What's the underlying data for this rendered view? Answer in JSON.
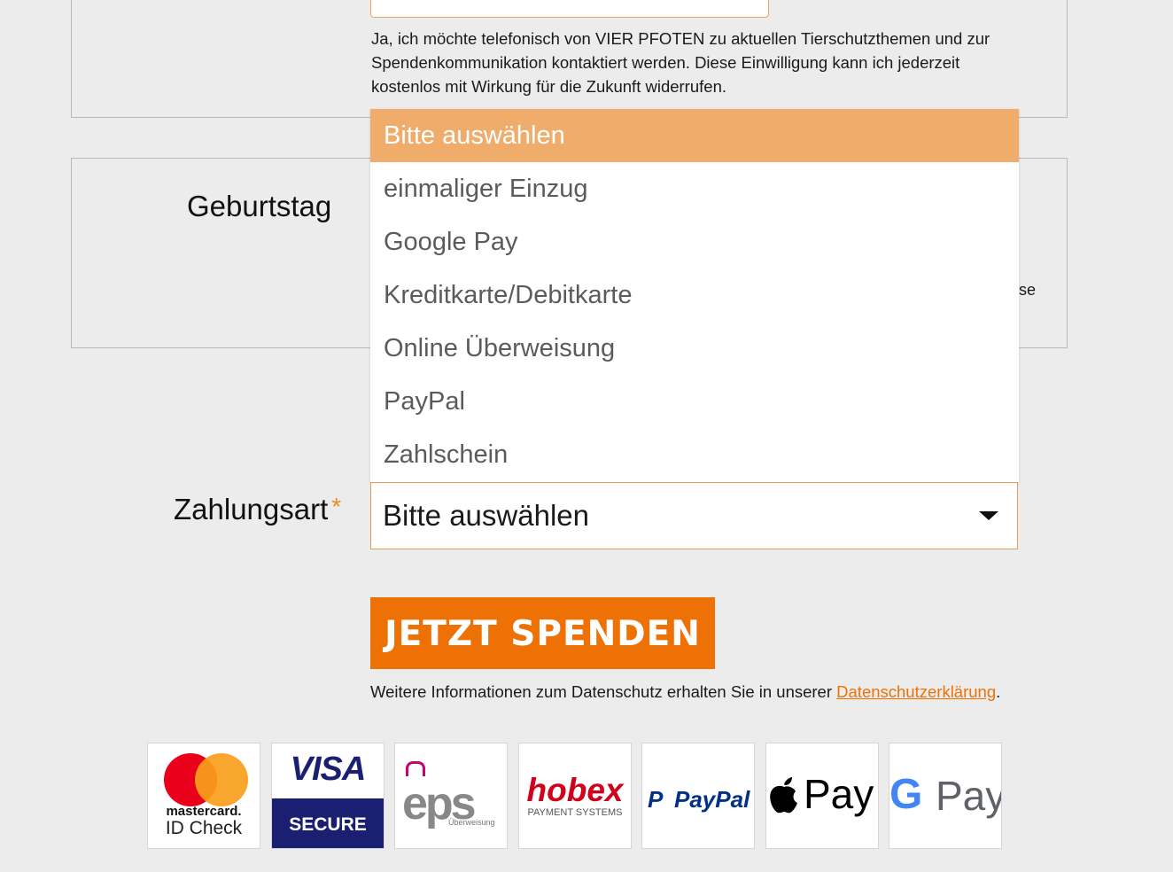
{
  "consent": {
    "text": "Ja, ich möchte telefonisch von VIER PFOTEN zu aktuellen Tierschutzthemen und zur Spendenkommunikation kontaktiert werden. Diese Einwilligung kann ich jederzeit kostenlos mit Wirkung für die Zukunft widerrufen."
  },
  "birthday": {
    "label": "Geburtstag",
    "clipped_text": "se"
  },
  "payment": {
    "label": "Zahlungsart",
    "required_marker": "*",
    "selected_value": "Bitte auswählen",
    "options": [
      "Bitte auswählen",
      "einmaliger Einzug",
      "Google Pay",
      "Kreditkarte/Debitkarte",
      "Online Überweisung",
      "PayPal",
      "Zahlschein"
    ]
  },
  "donate_button": {
    "label": "JETZT SPENDEN"
  },
  "privacy": {
    "text": "Weitere Informationen zum Datenschutz erhalten Sie in unserer ",
    "link": "Datenschutzerklärung",
    "period": "."
  },
  "logos": {
    "mastercard": {
      "brand": "mastercard.",
      "sub": "ID Check"
    },
    "visa": {
      "brand": "VISA",
      "sub": "SECURE"
    },
    "eps": {
      "brand": "eps",
      "sub": "Überweisung"
    },
    "hobex": {
      "brand": "hobex",
      "sub": "PAYMENT SYSTEMS"
    },
    "paypal": {
      "brand": "PayPal"
    },
    "applepay": {
      "brand": "Pay"
    },
    "googlepay": {
      "brand": "Pay"
    }
  },
  "colors": {
    "accent": "#ee7106",
    "dropdown_highlight": "#f0ac6a",
    "background": "#ececec"
  }
}
